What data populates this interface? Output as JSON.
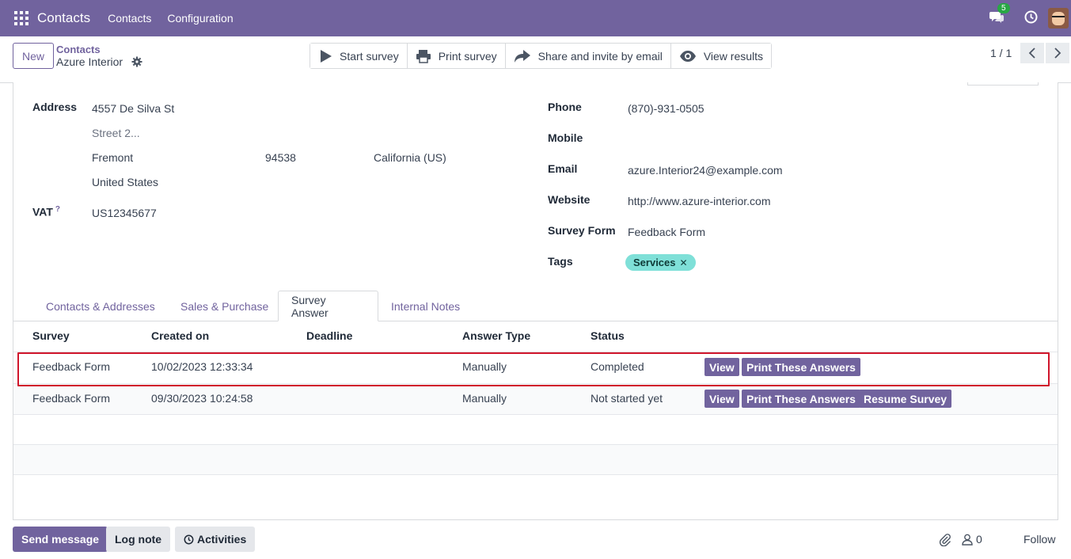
{
  "navbar": {
    "app_name": "Contacts",
    "menu": [
      "Contacts",
      "Configuration"
    ],
    "message_count": "5",
    "bg_color": "#71639e"
  },
  "control": {
    "new_label": "New",
    "breadcrumb_parent": "Contacts",
    "breadcrumb_current": "Azure Interior",
    "actions": [
      {
        "label": "Start survey",
        "icon": "play-icon"
      },
      {
        "label": "Print survey",
        "icon": "printer-icon"
      },
      {
        "label": "Share and invite by email",
        "icon": "share-icon"
      },
      {
        "label": "View results",
        "icon": "eye-icon"
      }
    ],
    "pager": "1 / 1"
  },
  "form": {
    "address_label": "Address",
    "street": "4557 De Silva St",
    "street2_placeholder": "Street 2...",
    "city": "Fremont",
    "zip": "94538",
    "state": "California (US)",
    "country": "United States",
    "vat_label": "VAT",
    "vat_help": "?",
    "vat": "US12345677",
    "phone_label": "Phone",
    "phone": "(870)-931-0505",
    "mobile_label": "Mobile",
    "mobile": "",
    "email_label": "Email",
    "email": "azure.Interior24@example.com",
    "website_label": "Website",
    "website": "http://www.azure-interior.com",
    "survey_form_label": "Survey Form",
    "survey_form": "Feedback Form",
    "tags_label": "Tags",
    "tags": [
      {
        "label": "Services",
        "color": "#7fe0d8"
      }
    ]
  },
  "tabs": [
    "Contacts & Addresses",
    "Sales & Purchase",
    "Survey Answer",
    "Internal Notes"
  ],
  "active_tab": "Survey Answer",
  "table": {
    "columns": [
      "Survey",
      "Created on",
      "Deadline",
      "Answer Type",
      "Status"
    ],
    "rows": [
      {
        "survey": "Feedback Form",
        "created_on": "10/02/2023 12:33:34",
        "deadline": "",
        "answer_type": "Manually",
        "status": "Completed",
        "buttons": [
          "View",
          "Print These Answers"
        ]
      },
      {
        "survey": "Feedback Form",
        "created_on": "09/30/2023 10:24:58",
        "deadline": "",
        "answer_type": "Manually",
        "status": "Not started yet",
        "buttons": [
          "View",
          "Print These Answers",
          "Resume Survey"
        ]
      }
    ]
  },
  "chatter": {
    "send_message": "Send message",
    "log_note": "Log note",
    "activities": "Activities",
    "followers": "0",
    "follow": "Follow"
  },
  "colors": {
    "accent": "#71639e",
    "highlight": "#d0152b"
  }
}
